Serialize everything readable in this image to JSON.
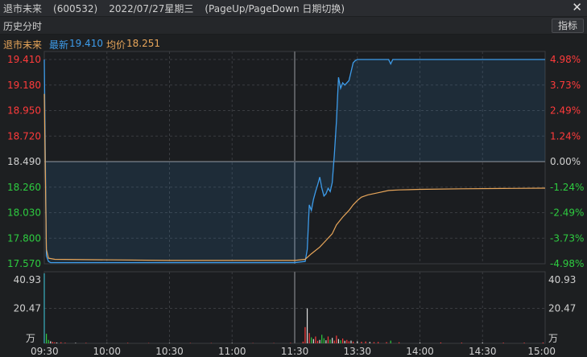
{
  "window": {
    "name": "退市未来",
    "code": "(600532)",
    "date": "2022/07/27星期三",
    "hint": "(PageUp/PageDown 日期切换)",
    "close_glyph": "✕"
  },
  "toolbar": {
    "label": "历史分时",
    "indicator_button": "指标"
  },
  "info": {
    "name": "退市未来",
    "latest_label": "最新",
    "latest_value": "19.410",
    "avg_label": "均价",
    "avg_value": "18.251"
  },
  "colors": {
    "up": "#ff3b3b",
    "down": "#2ecc40",
    "flat": "#d0d0d0",
    "price_line": "#3d9be9",
    "avg_line": "#e8a65a",
    "latest_text": "#3d9be9",
    "avg_text": "#e8a65a",
    "grid": "#3a3c40"
  },
  "chart_data": {
    "type": "line",
    "title": "",
    "prev_close": 18.49,
    "price_axis": {
      "ticks": [
        "19.410",
        "19.180",
        "18.950",
        "18.720",
        "18.490",
        "18.260",
        "18.030",
        "17.800",
        "17.570"
      ],
      "range": [
        17.57,
        19.41
      ]
    },
    "percent_axis": {
      "ticks": [
        "4.98%",
        "3.73%",
        "2.49%",
        "1.24%",
        "0.00%",
        "-1.24%",
        "-2.49%",
        "-3.73%",
        "-4.98%"
      ]
    },
    "volume_axis": {
      "ticks": [
        "40.93",
        "20.47"
      ],
      "unit": "万",
      "max": 40.93
    },
    "time_axis": {
      "ticks": [
        "09:30",
        "10:00",
        "10:30",
        "11:00",
        "11:30",
        "13:30",
        "14:00",
        "14:30",
        "15:00"
      ]
    },
    "minutes_total": 240,
    "price_series": [
      [
        0,
        19.41
      ],
      [
        1,
        17.64
      ],
      [
        2,
        17.59
      ],
      [
        3,
        17.58
      ],
      [
        10,
        17.58
      ],
      [
        60,
        17.58
      ],
      [
        120,
        17.58
      ],
      [
        125,
        17.59
      ],
      [
        126,
        17.7
      ],
      [
        127,
        18.1
      ],
      [
        128,
        18.05
      ],
      [
        129,
        18.15
      ],
      [
        130,
        18.22
      ],
      [
        131,
        18.28
      ],
      [
        132,
        18.35
      ],
      [
        133,
        18.25
      ],
      [
        134,
        18.18
      ],
      [
        135,
        18.2
      ],
      [
        136,
        18.25
      ],
      [
        137,
        18.22
      ],
      [
        138,
        18.3
      ],
      [
        139,
        18.55
      ],
      [
        140,
        18.85
      ],
      [
        141,
        19.25
      ],
      [
        142,
        19.15
      ],
      [
        143,
        19.2
      ],
      [
        144,
        19.18
      ],
      [
        145,
        19.2
      ],
      [
        146,
        19.22
      ],
      [
        147,
        19.3
      ],
      [
        148,
        19.38
      ],
      [
        149,
        19.4
      ],
      [
        150,
        19.41
      ],
      [
        160,
        19.41
      ],
      [
        165,
        19.41
      ],
      [
        166,
        19.37
      ],
      [
        167,
        19.41
      ],
      [
        240,
        19.41
      ]
    ],
    "avg_series": [
      [
        0,
        19.1
      ],
      [
        1,
        17.7
      ],
      [
        2,
        17.62
      ],
      [
        5,
        17.61
      ],
      [
        60,
        17.6
      ],
      [
        120,
        17.6
      ],
      [
        125,
        17.61
      ],
      [
        128,
        17.66
      ],
      [
        132,
        17.72
      ],
      [
        135,
        17.78
      ],
      [
        138,
        17.84
      ],
      [
        140,
        17.92
      ],
      [
        143,
        17.99
      ],
      [
        146,
        18.05
      ],
      [
        148,
        18.1
      ],
      [
        150,
        18.14
      ],
      [
        152,
        18.17
      ],
      [
        155,
        18.19
      ],
      [
        160,
        18.21
      ],
      [
        165,
        18.23
      ],
      [
        170,
        18.235
      ],
      [
        180,
        18.24
      ],
      [
        200,
        18.245
      ],
      [
        220,
        18.248
      ],
      [
        240,
        18.251
      ]
    ],
    "volume_series": [
      [
        0,
        40.93
      ],
      [
        1,
        5.6
      ],
      [
        2,
        2.0
      ],
      [
        3,
        1.2
      ],
      [
        4,
        0.8
      ],
      [
        5,
        0.6
      ],
      [
        6,
        0.5
      ],
      [
        8,
        0.6
      ],
      [
        10,
        0.4
      ],
      [
        15,
        0.3
      ],
      [
        20,
        0.3
      ],
      [
        30,
        0.2
      ],
      [
        40,
        0.3
      ],
      [
        50,
        0.2
      ],
      [
        60,
        0.3
      ],
      [
        70,
        0.2
      ],
      [
        80,
        0.2
      ],
      [
        90,
        0.3
      ],
      [
        100,
        0.2
      ],
      [
        110,
        0.2
      ],
      [
        118,
        0.3
      ],
      [
        124,
        1.0
      ],
      [
        125,
        9.5
      ],
      [
        126,
        20.47
      ],
      [
        127,
        6.0
      ],
      [
        128,
        3.5
      ],
      [
        129,
        2.5
      ],
      [
        130,
        4.0
      ],
      [
        131,
        1.5
      ],
      [
        132,
        2.0
      ],
      [
        133,
        5.0
      ],
      [
        134,
        3.0
      ],
      [
        135,
        1.8
      ],
      [
        136,
        4.0
      ],
      [
        137,
        2.2
      ],
      [
        138,
        3.2
      ],
      [
        139,
        1.6
      ],
      [
        140,
        4.5
      ],
      [
        141,
        2.5
      ],
      [
        142,
        1.8
      ],
      [
        143,
        2.8
      ],
      [
        144,
        1.5
      ],
      [
        145,
        2.0
      ],
      [
        146,
        1.2
      ],
      [
        147,
        1.6
      ],
      [
        148,
        1.0
      ],
      [
        150,
        1.2
      ],
      [
        152,
        0.9
      ],
      [
        154,
        1.1
      ],
      [
        156,
        0.8
      ],
      [
        158,
        0.7
      ],
      [
        160,
        0.8
      ],
      [
        164,
        0.7
      ],
      [
        166,
        1.6
      ],
      [
        170,
        0.6
      ],
      [
        180,
        0.5
      ],
      [
        190,
        0.5
      ],
      [
        200,
        0.4
      ],
      [
        210,
        0.5
      ],
      [
        220,
        0.4
      ],
      [
        230,
        0.4
      ],
      [
        239,
        0.5
      ]
    ]
  }
}
